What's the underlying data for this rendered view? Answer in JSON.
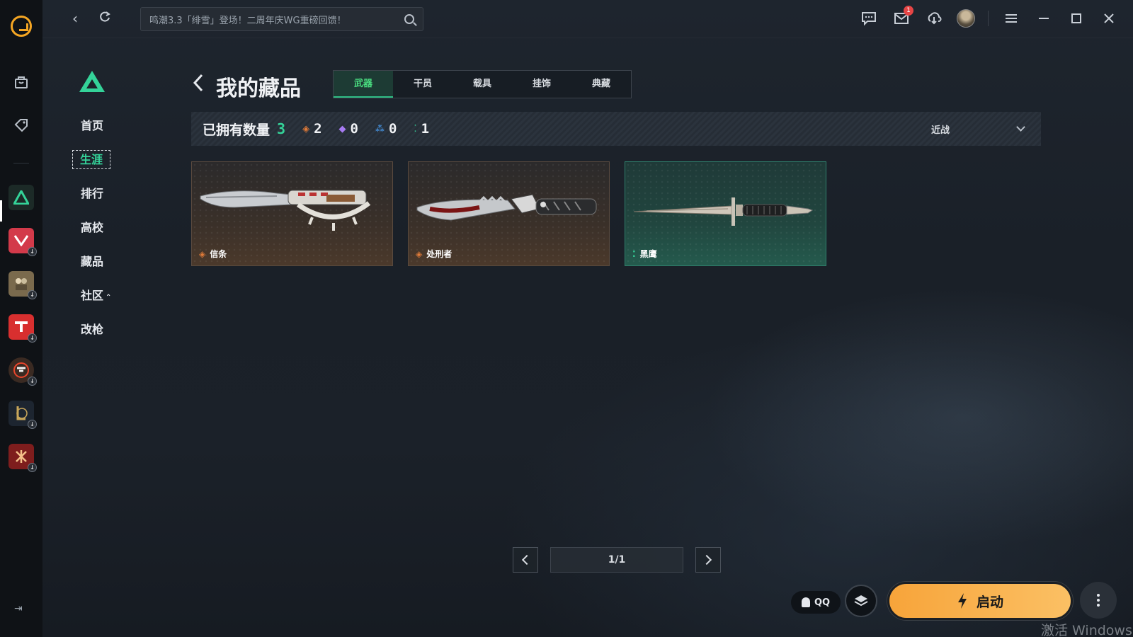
{
  "topbar": {
    "search_text": "鸣潮3.3「绯雪」登场！二周年庆WG重磅回馈！",
    "mail_badge": "1"
  },
  "subnav": {
    "items": [
      {
        "label": "首页"
      },
      {
        "label": "生涯",
        "active": true
      },
      {
        "label": "排行"
      },
      {
        "label": "高校"
      },
      {
        "label": "藏品"
      },
      {
        "label": "社区"
      },
      {
        "label": "改枪"
      }
    ]
  },
  "header": {
    "title": "我的藏品",
    "tabs": [
      {
        "label": "武器",
        "active": true
      },
      {
        "label": "干员"
      },
      {
        "label": "载具"
      },
      {
        "label": "挂饰"
      },
      {
        "label": "典藏"
      }
    ]
  },
  "stats": {
    "owned_label": "已拥有数量",
    "owned_count": "3",
    "rarity_counts": [
      {
        "color": "#e07b39",
        "count": "2"
      },
      {
        "color": "#a77bf2",
        "count": "0"
      },
      {
        "color": "#4a9ff5",
        "count": "0"
      },
      {
        "color": "#34d399",
        "count": "1"
      }
    ],
    "filter_label": "近战"
  },
  "items": [
    {
      "name": "信条",
      "rarity_color": "#e07b39",
      "style": "orange"
    },
    {
      "name": "处刑者",
      "rarity_color": "#e07b39",
      "style": "orange"
    },
    {
      "name": "黑鹰",
      "rarity_color": "#34d399",
      "style": "green"
    }
  ],
  "pagination": {
    "display": "1/1"
  },
  "bottom": {
    "qq_label": "QQ",
    "launch_label": "启动"
  },
  "watermark": "激活 Windows",
  "colors": {
    "accent": "#34d399",
    "launch": "#f7a43a"
  }
}
